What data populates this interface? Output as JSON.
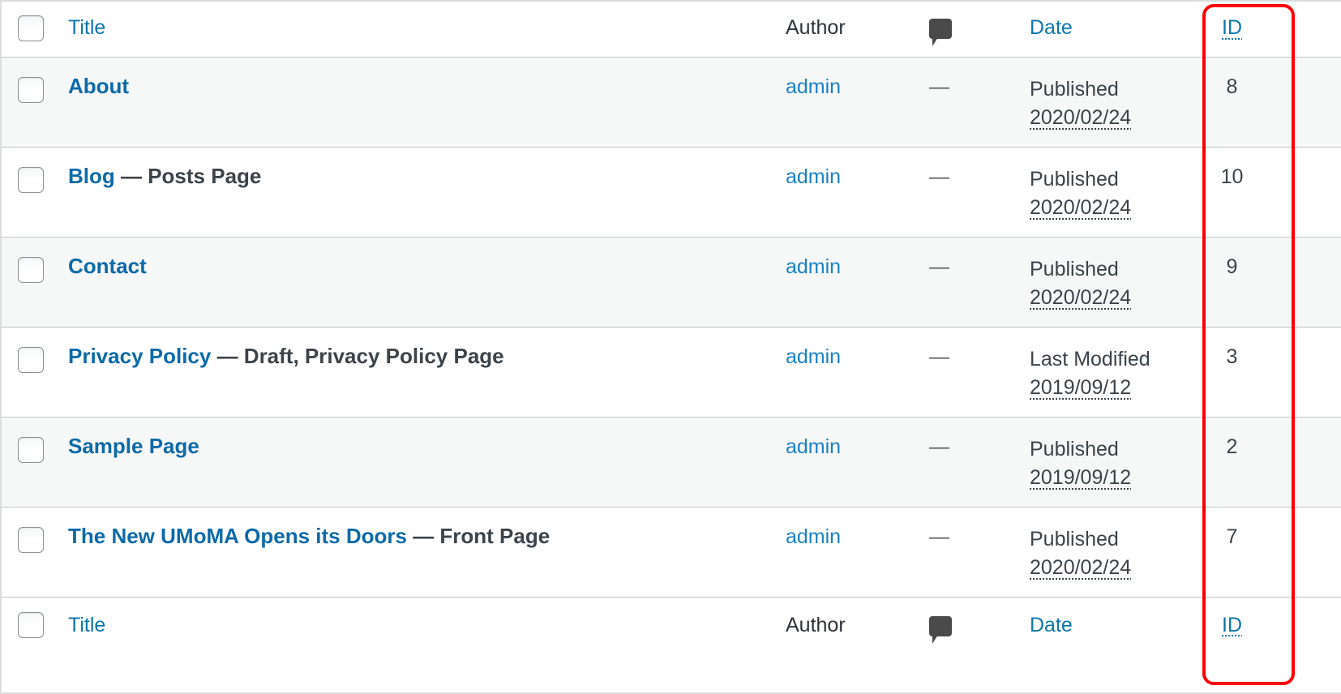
{
  "colors": {
    "link": "#0d76ab",
    "row_link": "#0d6aa8",
    "text": "#3c434a",
    "row_alt_bg": "#f6f7f7",
    "row_bg": "#ffffff",
    "border": "#c3c4c7",
    "annotation": "#fb0006",
    "bubble": "#4a4a4a"
  },
  "table": {
    "columns": {
      "select_all_label": "",
      "title": "Title",
      "author": "Author",
      "comments_icon": "comment-bubble-icon",
      "date": "Date",
      "id": "ID"
    },
    "footer_columns": {
      "title": "Title",
      "author": "Author",
      "comments_icon": "comment-bubble-icon",
      "date": "Date",
      "id": "ID"
    },
    "rows": [
      {
        "title": "About",
        "suffix": "",
        "author": "admin",
        "comments": "—",
        "date_status": "Published",
        "date": "2020/02/24",
        "id": "8",
        "shade": "alt"
      },
      {
        "title": "Blog",
        "suffix": " — Posts Page",
        "author": "admin",
        "comments": "—",
        "date_status": "Published",
        "date": "2020/02/24",
        "id": "10",
        "shade": "plain"
      },
      {
        "title": "Contact",
        "suffix": "",
        "author": "admin",
        "comments": "—",
        "date_status": "Published",
        "date": "2020/02/24",
        "id": "9",
        "shade": "alt"
      },
      {
        "title": "Privacy Policy",
        "suffix": " — Draft, Privacy Policy Page",
        "author": "admin",
        "comments": "—",
        "date_status": "Last Modified",
        "date": "2019/09/12",
        "id": "3",
        "shade": "plain"
      },
      {
        "title": "Sample Page",
        "suffix": "",
        "author": "admin",
        "comments": "—",
        "date_status": "Published",
        "date": "2019/09/12",
        "id": "2",
        "shade": "alt"
      },
      {
        "title": "The New UMoMA Opens its Doors",
        "suffix": " — Front Page",
        "author": "admin",
        "comments": "—",
        "date_status": "Published",
        "date": "2020/02/24",
        "id": "7",
        "shade": "plain"
      }
    ]
  },
  "annotation": {
    "target_column": "ID",
    "shape": "rounded-rectangle"
  }
}
